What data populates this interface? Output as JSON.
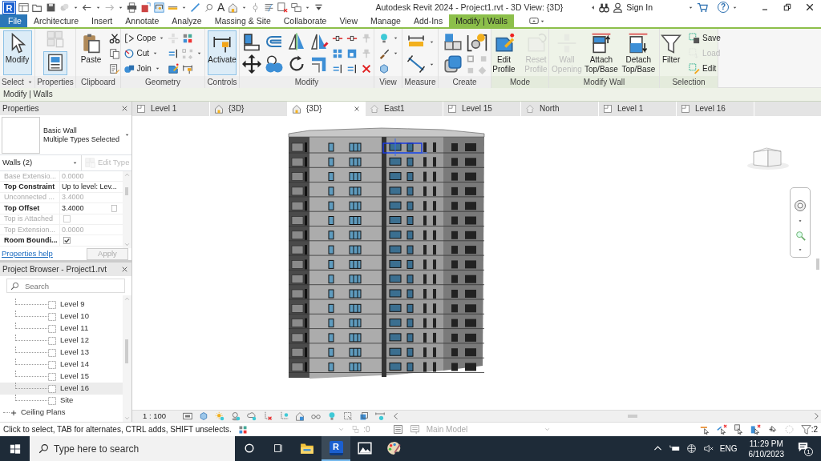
{
  "app": {
    "logo": "R"
  },
  "window": {
    "title": "Autodesk Revit 2024 - Project1.rvt - 3D View: {3D}",
    "sign_in": "Sign In",
    "help": "?"
  },
  "quick_access": {
    "text_tool": "A"
  },
  "ribbon_tabs": [
    {
      "label": "File",
      "kind": "file",
      "selected": false
    },
    {
      "label": "Architecture",
      "kind": "normal",
      "selected": false
    },
    {
      "label": "Insert",
      "kind": "normal",
      "selected": false
    },
    {
      "label": "Annotate",
      "kind": "normal",
      "selected": false
    },
    {
      "label": "Analyze",
      "kind": "normal",
      "selected": false
    },
    {
      "label": "Massing & Site",
      "kind": "normal",
      "selected": false
    },
    {
      "label": "Collaborate",
      "kind": "normal",
      "selected": false
    },
    {
      "label": "View",
      "kind": "normal",
      "selected": false
    },
    {
      "label": "Manage",
      "kind": "normal",
      "selected": false
    },
    {
      "label": "Add-Ins",
      "kind": "normal",
      "selected": false
    },
    {
      "label": "Modify | Walls",
      "kind": "contextual",
      "selected": true
    }
  ],
  "ribbon_panels": [
    {
      "label": "Select",
      "kind": "normal",
      "tools": [
        {
          "label": "Modify",
          "selected": true,
          "disabled": false
        }
      ]
    },
    {
      "label": "Properties",
      "kind": "normal",
      "tools": [
        {
          "selected": true
        }
      ]
    },
    {
      "label": "Clipboard",
      "kind": "normal",
      "tools": [
        {
          "label": "Paste",
          "selected": false,
          "disabled": false
        }
      ]
    },
    {
      "label": "Geometry",
      "kind": "normal",
      "tools": [
        {
          "label": "Cope",
          "selected": false,
          "disabled": false
        },
        {
          "label": "Cut",
          "selected": false,
          "disabled": false
        },
        {
          "label": "Join",
          "selected": false,
          "disabled": false
        }
      ]
    },
    {
      "label": "Controls",
      "kind": "normal",
      "tools": [
        {
          "label": "Activate",
          "selected": true,
          "disabled": false
        }
      ]
    },
    {
      "label": "Modify",
      "kind": "normal"
    },
    {
      "label": "View",
      "kind": "normal"
    },
    {
      "label": "Measure",
      "kind": "normal"
    },
    {
      "label": "Create",
      "kind": "normal"
    },
    {
      "label": "Mode",
      "kind": "contextual",
      "tools": [
        {
          "label": "Edit Profile",
          "selected": false,
          "disabled": false
        },
        {
          "label": "Reset Profile",
          "selected": false,
          "disabled": true
        }
      ]
    },
    {
      "label": "Modify Wall",
      "kind": "contextual",
      "tools": [
        {
          "label": "Wall Opening",
          "selected": false,
          "disabled": true
        },
        {
          "label": "Attach Top/Base",
          "selected": false,
          "disabled": false
        },
        {
          "label": "Detach Top/Base",
          "selected": false,
          "disabled": false
        }
      ]
    },
    {
      "label": "Selection",
      "kind": "contextual",
      "tools": [
        {
          "label": "Filter",
          "selected": false,
          "disabled": false
        },
        {
          "label": "Save",
          "selected": false,
          "disabled": false
        },
        {
          "label": "Load",
          "selected": false,
          "disabled": true
        },
        {
          "label": "Edit",
          "selected": false,
          "disabled": false
        }
      ]
    }
  ],
  "context_bar": "Modify | Walls",
  "properties": {
    "title": "Properties",
    "type_family": "Basic Wall",
    "type_name": "Multiple Types Selected",
    "category": "Walls (2)",
    "edit_type": {
      "label": "Edit Type",
      "disabled": true
    },
    "rows": [
      {
        "name": "Base Extensio...",
        "value": "0.0000",
        "kind": "text",
        "disabled": true
      },
      {
        "name": "Top Constraint",
        "value": "Up to level: Lev...",
        "kind": "text",
        "disabled": false
      },
      {
        "name": "Unconnected ...",
        "value": "3.4000",
        "kind": "text",
        "disabled": true
      },
      {
        "name": "Top Offset",
        "value": "3.4000",
        "kind": "text",
        "disabled": false
      },
      {
        "name": "Top is Attached",
        "kind": "checkbox",
        "checked": false,
        "disabled": true
      },
      {
        "name": "Top Extension...",
        "value": "0.0000",
        "kind": "text",
        "disabled": true
      },
      {
        "name": "Room Boundi...",
        "kind": "checkbox",
        "checked": true,
        "disabled": false
      }
    ],
    "help_link": "Properties help",
    "apply": {
      "label": "Apply",
      "disabled": true
    }
  },
  "project_browser": {
    "title": "Project Browser - Project1.rvt",
    "search": {
      "placeholder": "Search"
    },
    "floor_plans": [
      {
        "label": "Level 9",
        "selected": false
      },
      {
        "label": "Level 10",
        "selected": false
      },
      {
        "label": "Level 11",
        "selected": false
      },
      {
        "label": "Level 12",
        "selected": false
      },
      {
        "label": "Level 13",
        "selected": false
      },
      {
        "label": "Level 14",
        "selected": false
      },
      {
        "label": "Level 15",
        "selected": false
      },
      {
        "label": "Level 16",
        "selected": true
      },
      {
        "label": "Site",
        "selected": false
      }
    ],
    "sections": [
      {
        "label": "Ceiling Plans",
        "expanded": false
      }
    ]
  },
  "view_tabs": [
    {
      "label": "Level 1",
      "kind": "plan",
      "selected": false
    },
    {
      "label": "{3D}",
      "kind": "model",
      "selected": false
    },
    {
      "label": "{3D}",
      "kind": "model",
      "selected": true
    },
    {
      "label": "East1",
      "kind": "elevation",
      "selected": false
    },
    {
      "label": "Level 15",
      "kind": "plan",
      "selected": false
    },
    {
      "label": "North",
      "kind": "elevation",
      "selected": false
    },
    {
      "label": "Level 1",
      "kind": "plan",
      "selected": false
    },
    {
      "label": "Level 16",
      "kind": "plan",
      "selected": false
    }
  ],
  "view_control_bar": {
    "scale": "1 : 100"
  },
  "status_bar": {
    "message": "Click to select, TAB for alternates, CTRL adds, SHIFT unselects.",
    "worksets": ":0",
    "design_option": "Main Model",
    "selection_count": ":2"
  },
  "taskbar": {
    "search": {
      "placeholder": "Type here to search"
    },
    "apps": [
      {
        "kind": "folder",
        "selected": false
      },
      {
        "kind": "revit",
        "selected": true,
        "letter": "R"
      },
      {
        "kind": "photos",
        "selected": false
      },
      {
        "kind": "paint",
        "selected": false
      }
    ],
    "language": "ENG",
    "time": "11:29 PM",
    "date": "6/10/2023",
    "notifications": "1"
  }
}
